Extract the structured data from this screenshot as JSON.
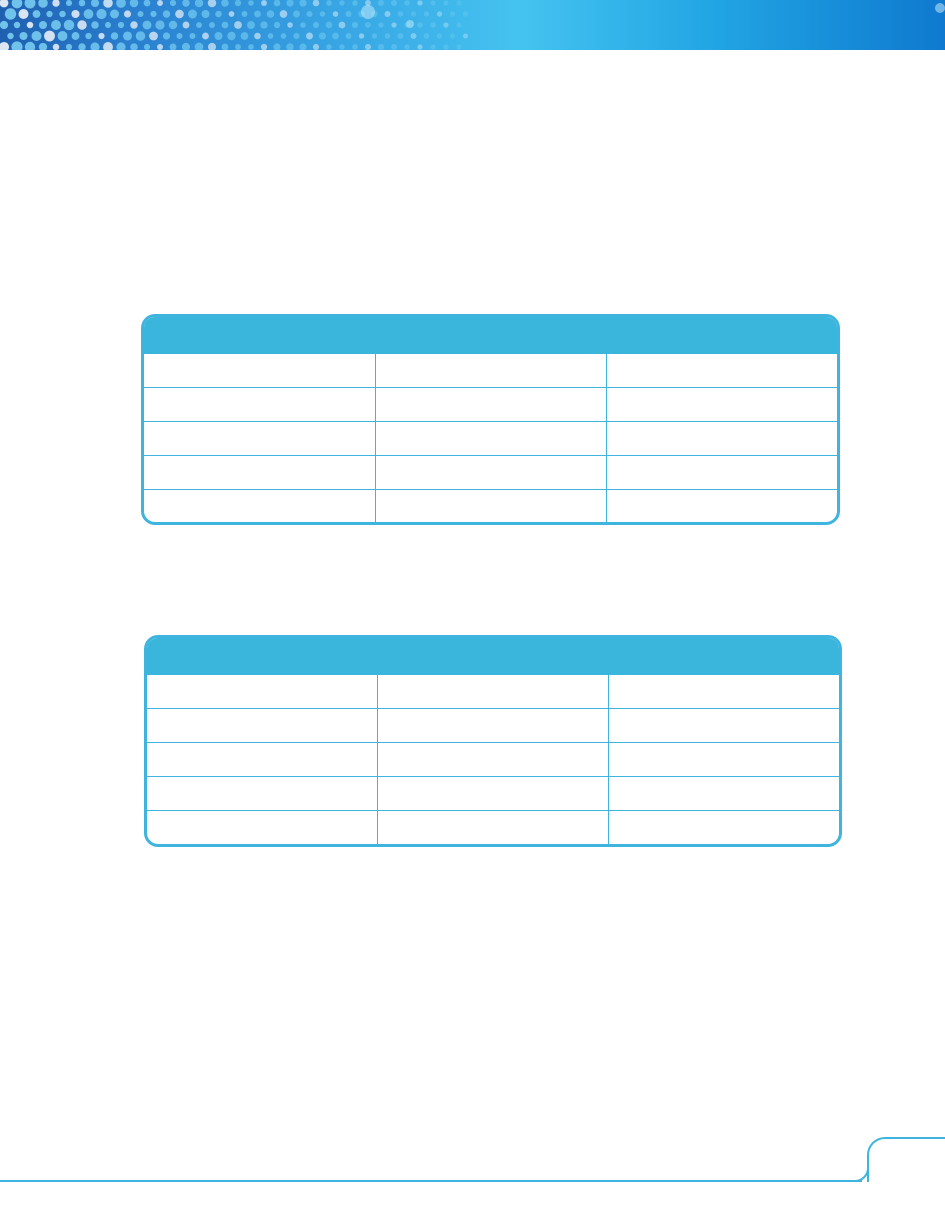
{
  "colors": {
    "accent": "#3ab5dc",
    "banner_dark": "#1f5fb0",
    "banner_light": "#45c3f0"
  },
  "header": {
    "decoration": "blue-dot-pattern-banner"
  },
  "tables": [
    {
      "columns": 3,
      "header": [
        "",
        "",
        ""
      ],
      "rows": [
        [
          "",
          "",
          ""
        ],
        [
          "",
          "",
          ""
        ],
        [
          "",
          "",
          ""
        ],
        [
          "",
          "",
          ""
        ],
        [
          "",
          "",
          ""
        ]
      ]
    },
    {
      "columns": 3,
      "header": [
        "",
        "",
        ""
      ],
      "rows": [
        [
          "",
          "",
          ""
        ],
        [
          "",
          "",
          ""
        ],
        [
          "",
          "",
          ""
        ],
        [
          "",
          "",
          ""
        ],
        [
          "",
          "",
          ""
        ]
      ]
    }
  ],
  "footer": {
    "page_number": ""
  }
}
